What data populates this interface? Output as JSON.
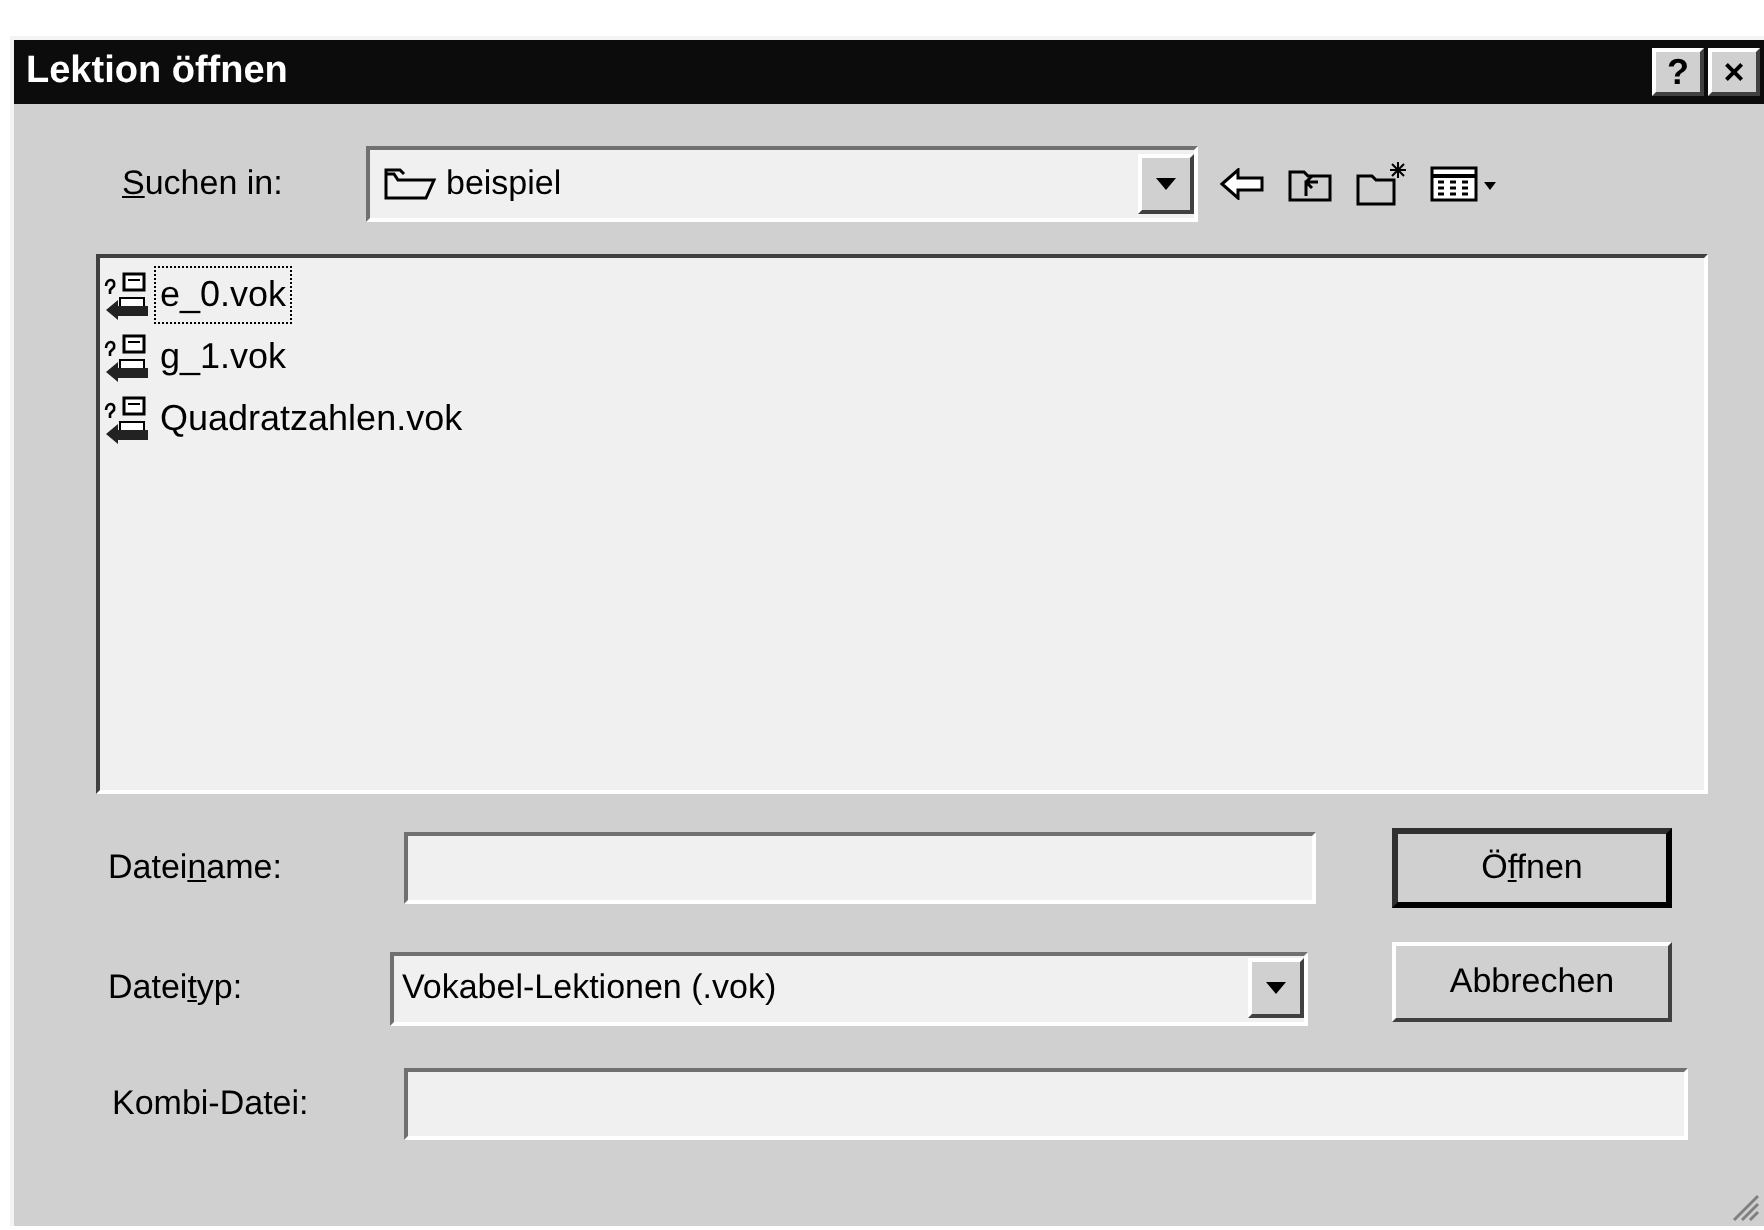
{
  "window": {
    "title": "Lektion öffnen",
    "title_buttons": [
      {
        "label": "?"
      },
      {
        "label": "×"
      }
    ]
  },
  "look_in": {
    "label": [
      {
        "text": "S",
        "underline": true
      },
      {
        "text": "uchen in:",
        "underline": false
      }
    ],
    "value": "beispiel"
  },
  "files": [
    {
      "name": "e_0.vok",
      "focused": true
    },
    {
      "name": "g_1.vok",
      "focused": false
    },
    {
      "name": "Quadratzahlen.vok",
      "focused": false
    }
  ],
  "filename": {
    "label": [
      {
        "text": "Datei",
        "underline": false
      },
      {
        "text": "n",
        "underline": true
      },
      {
        "text": "ame:",
        "underline": false
      }
    ]
  },
  "filetype": {
    "label": [
      {
        "text": "Datei",
        "underline": false
      },
      {
        "text": "t",
        "underline": true
      },
      {
        "text": "yp:",
        "underline": false
      }
    ],
    "value": "Vokabel-Lektionen (.vok)"
  },
  "combo_file": {
    "label": "Kombi-Datei:"
  },
  "buttons": [
    {
      "label": [
        {
          "text": "Ö",
          "underline": false
        },
        {
          "text": "f",
          "underline": true
        },
        {
          "text": "fnen",
          "underline": false
        }
      ],
      "default": true
    },
    {
      "label": [
        {
          "text": "Abbrechen",
          "underline": false
        }
      ],
      "default": false
    }
  ]
}
